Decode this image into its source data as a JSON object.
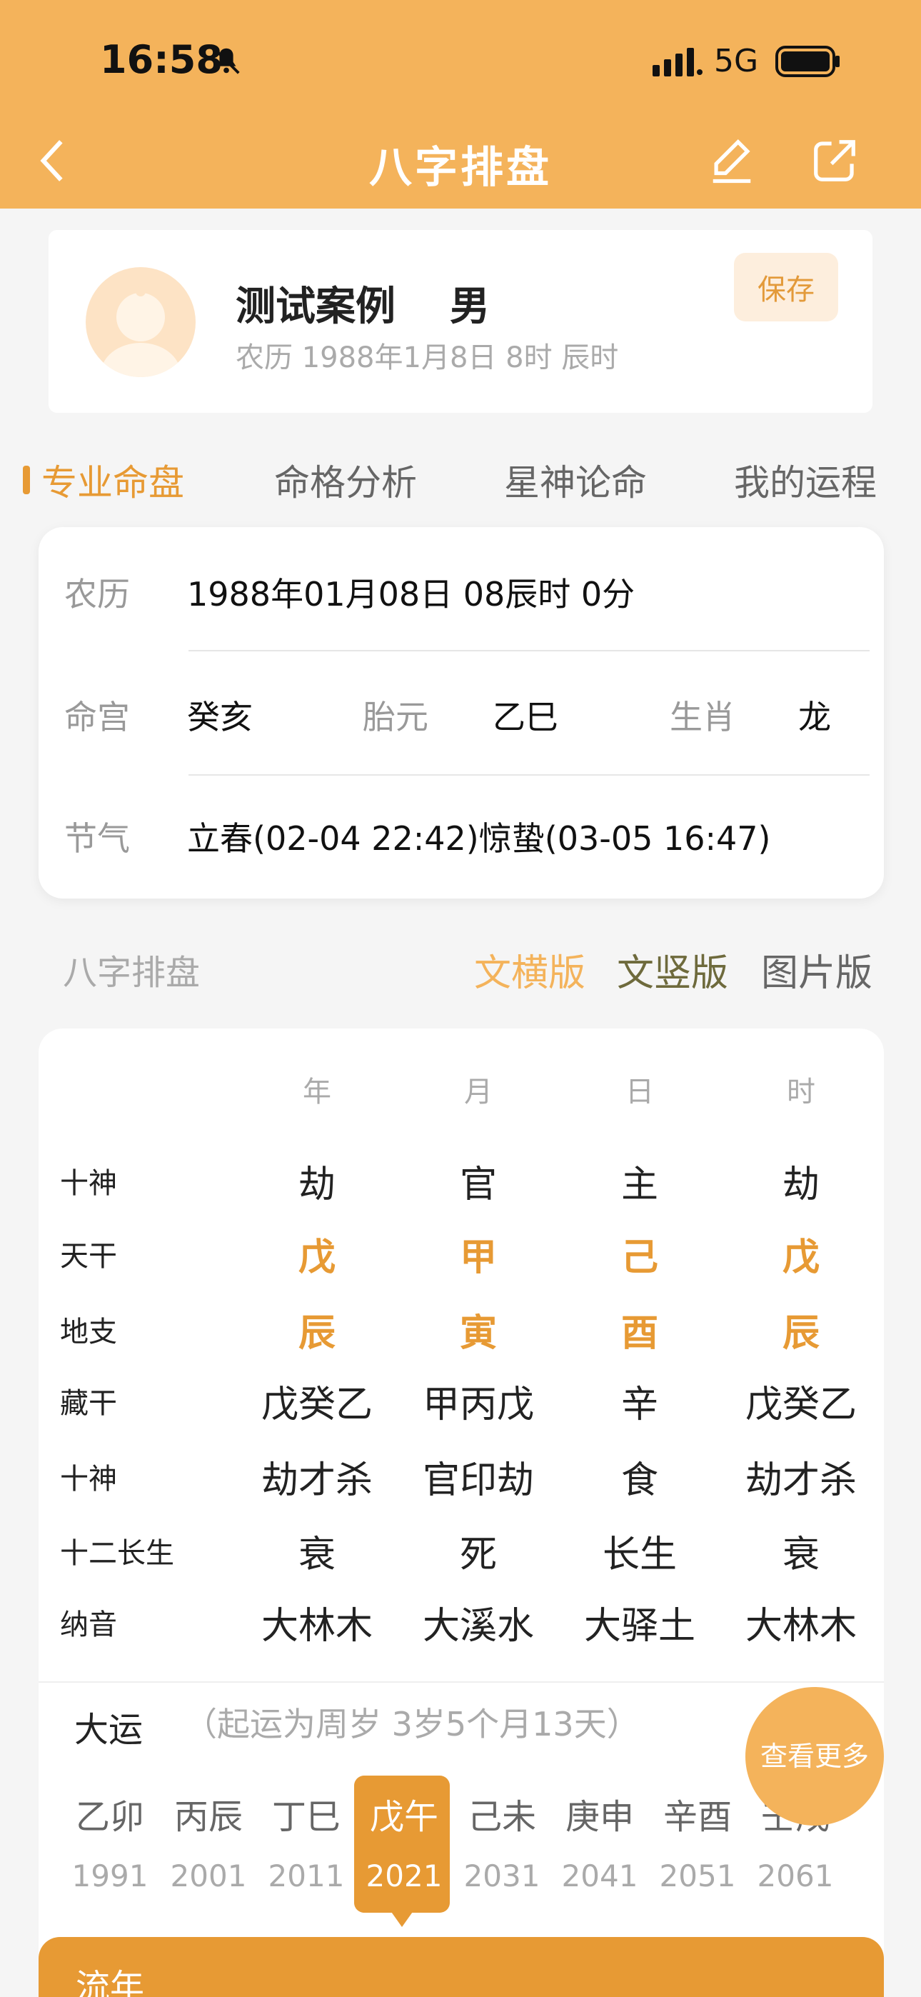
{
  "status_bar": {
    "time": "16:58",
    "network": "5G"
  },
  "header": {
    "title": "八字排盘"
  },
  "profile": {
    "name": "测试案例",
    "gender": "男",
    "lunar_birth": "农历 1988年1月8日 8时 辰时",
    "save_label": "保存"
  },
  "tabs": [
    {
      "label": "专业命盘",
      "active": true
    },
    {
      "label": "命格分析",
      "active": false
    },
    {
      "label": "星神论命",
      "active": false
    },
    {
      "label": "我的运程",
      "active": false
    }
  ],
  "info": {
    "lunar_label": "农历",
    "lunar_value": "1988年01月08日 08辰时 0分",
    "minggong_label": "命宫",
    "minggong_value": "癸亥",
    "taiyuan_label": "胎元",
    "taiyuan_value": "乙巳",
    "shengxiao_label": "生肖",
    "shengxiao_value": "龙",
    "jieqi_label": "节气",
    "jieqi_value": "立春(02-04 22:42)惊蛰(03-05 16:47)"
  },
  "bazi_section": {
    "title": "八字排盘",
    "versions": [
      {
        "label": "文横版",
        "color": "#f4b35b"
      },
      {
        "label": "文竖版",
        "color": "#6e6a3c"
      },
      {
        "label": "图片版",
        "color": "#666666"
      }
    ]
  },
  "bazi_table": {
    "columns": [
      "年",
      "月",
      "日",
      "时"
    ],
    "rows": [
      {
        "label": "十神",
        "values": [
          "劫",
          "官",
          "主",
          "劫"
        ],
        "highlight": false
      },
      {
        "label": "天干",
        "values": [
          "戊",
          "甲",
          "己",
          "戊"
        ],
        "highlight": true
      },
      {
        "label": "地支",
        "values": [
          "辰",
          "寅",
          "酉",
          "辰"
        ],
        "highlight": true
      },
      {
        "label": "藏干",
        "values": [
          "戊癸乙",
          "甲丙戊",
          "辛",
          "戊癸乙"
        ],
        "highlight": false
      },
      {
        "label": "十神",
        "values": [
          "劫才杀",
          "官印劫",
          "食",
          "劫才杀"
        ],
        "highlight": false
      },
      {
        "label": "十二长生",
        "values": [
          "衰",
          "死",
          "长生",
          "衰"
        ],
        "highlight": false
      },
      {
        "label": "纳音",
        "values": [
          "大林木",
          "大溪水",
          "大驿土",
          "大林木"
        ],
        "highlight": false
      }
    ]
  },
  "dayun": {
    "title": "大运",
    "note": "（起运为周岁 3岁5个月13天）",
    "more_label": "查看更多",
    "items": [
      {
        "ganzhi": "乙卯",
        "year": "1991",
        "active": false
      },
      {
        "ganzhi": "丙辰",
        "year": "2001",
        "active": false
      },
      {
        "ganzhi": "丁巳",
        "year": "2011",
        "active": false
      },
      {
        "ganzhi": "戊午",
        "year": "2021",
        "active": true
      },
      {
        "ganzhi": "己未",
        "year": "2031",
        "active": false
      },
      {
        "ganzhi": "庚申",
        "year": "2041",
        "active": false
      },
      {
        "ganzhi": "辛酉",
        "year": "2051",
        "active": false
      },
      {
        "ganzhi": "壬戌",
        "year": "2061",
        "active": false
      }
    ]
  },
  "liunian": {
    "title": "流年"
  },
  "colors": {
    "accent": "#e79a34",
    "header": "#f4b35b"
  }
}
